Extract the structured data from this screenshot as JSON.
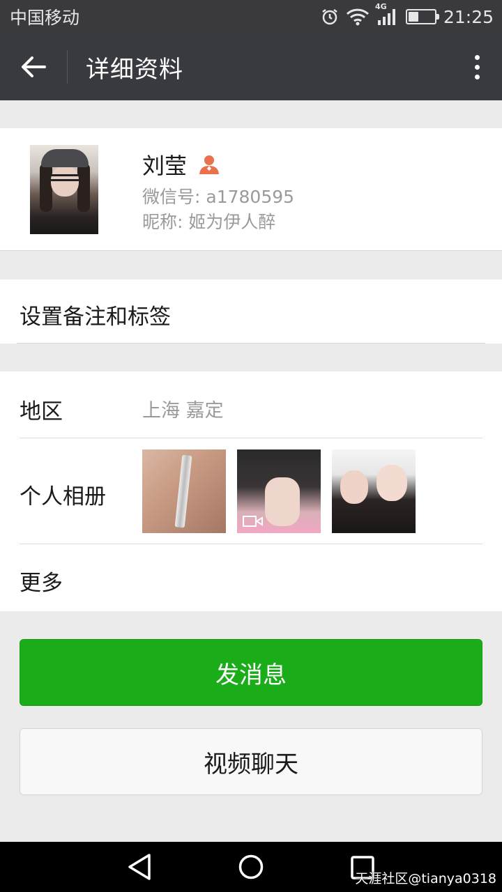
{
  "status_bar": {
    "carrier": "中国移动",
    "network": "4G",
    "time": "21:25",
    "battery_level": 0.4,
    "icons": [
      "alarm-icon",
      "wifi-icon",
      "signal-icon",
      "battery-icon"
    ]
  },
  "app_bar": {
    "title": "详细资料",
    "back_icon": "arrow-left-icon",
    "more_icon": "more-vertical-icon"
  },
  "profile": {
    "name": "刘莹",
    "gender_icon": "female-icon",
    "wechat_id": "微信号: a1780595",
    "nickname": "昵称: 姬为伊人醉"
  },
  "remark": {
    "label": "设置备注和标签"
  },
  "info": {
    "region_label": "地区",
    "region_value": "上海  嘉定",
    "album_label": "个人相册",
    "album_thumbs": [
      "photo-hand-pendant",
      "video-selfie",
      "photo-two-friends"
    ],
    "more_label": "更多"
  },
  "actions": {
    "send_message": "发消息",
    "video_chat": "视频聊天"
  },
  "nav": {
    "icons": [
      "nav-back-icon",
      "nav-home-icon",
      "nav-recent-icon"
    ]
  },
  "watermark": "天涯社区@tianya0318",
  "colors": {
    "primary_green": "#1aad19",
    "app_bar": "#393a3f",
    "background": "#ebebeb",
    "gender_icon": "#e9714c"
  }
}
